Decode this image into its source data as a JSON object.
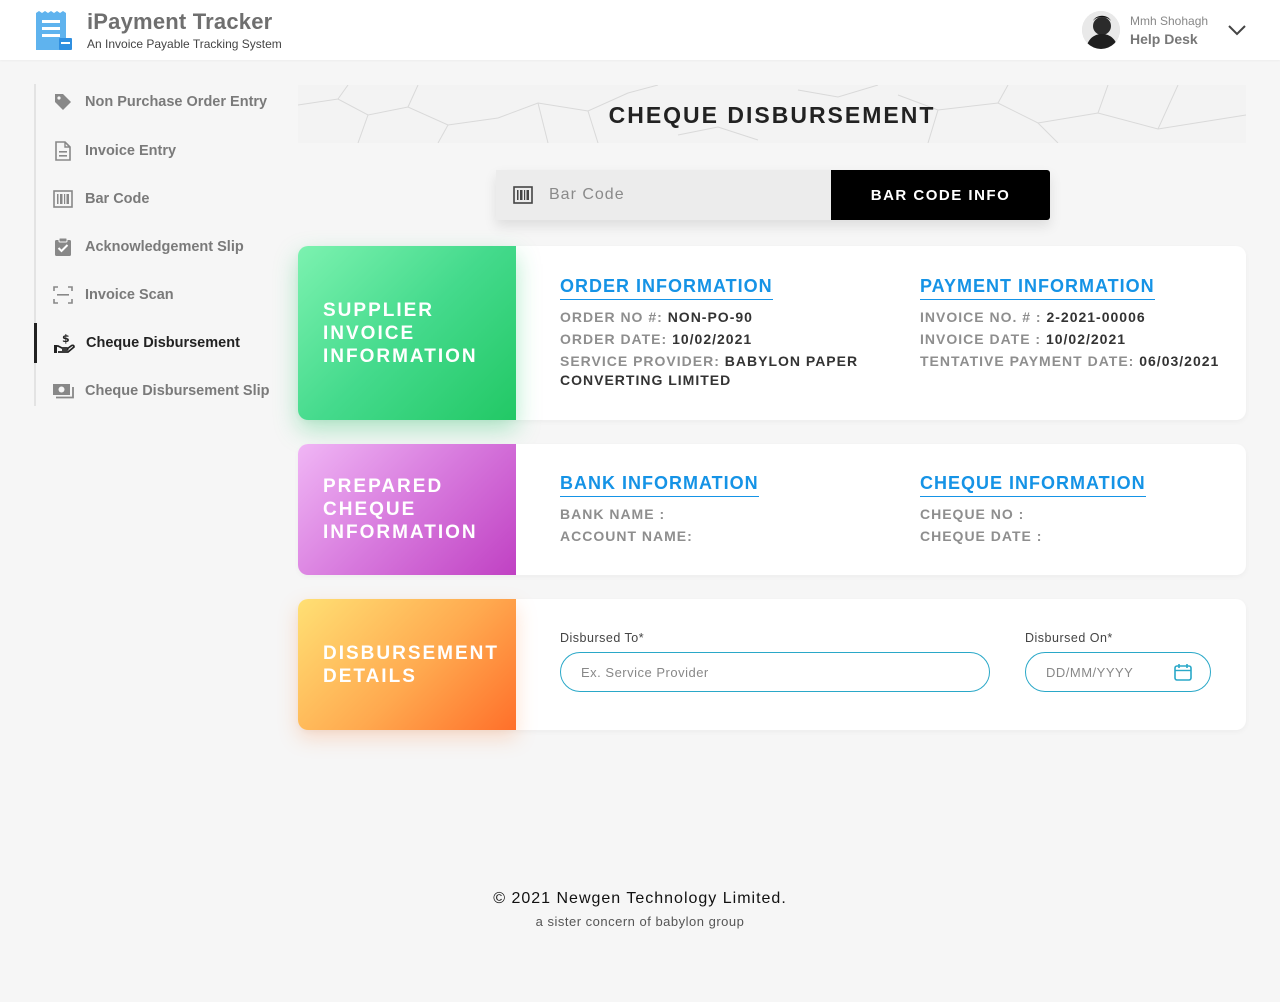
{
  "header": {
    "app_title": "iPayment Tracker",
    "app_subtitle": "An Invoice Payable Tracking System",
    "user_name": "Mmh Shohagh",
    "user_role": "Help Desk"
  },
  "sidebar": {
    "items": [
      {
        "label": "Non Purchase Order Entry",
        "icon": "tag-icon",
        "active": false
      },
      {
        "label": "Invoice Entry",
        "icon": "document-icon",
        "active": false
      },
      {
        "label": "Bar Code",
        "icon": "barcode-icon",
        "active": false
      },
      {
        "label": "Acknowledgement Slip",
        "icon": "clipboard-check-icon",
        "active": false
      },
      {
        "label": "Invoice Scan",
        "icon": "scan-icon",
        "active": false
      },
      {
        "label": "Cheque Disbursement",
        "icon": "hand-dollar-icon",
        "active": true
      },
      {
        "label": "Cheque Disbursement Slip",
        "icon": "cash-icon",
        "active": false
      }
    ]
  },
  "page": {
    "title": "CHEQUE DISBURSEMENT"
  },
  "barcode": {
    "placeholder": "Bar Code",
    "button_label": "BAR CODE INFO"
  },
  "supplier_card": {
    "tag": "SUPPLIER INVOICE INFORMATION",
    "order": {
      "title": "ORDER INFORMATION",
      "order_no_label": "ORDER NO #:",
      "order_no": "NON-PO-90",
      "order_date_label": "ORDER DATE:",
      "order_date": "10/02/2021",
      "provider_label": "SERVICE PROVIDER:",
      "provider": "BABYLON PAPER CONVERTING LIMITED"
    },
    "payment": {
      "title": "PAYMENT INFORMATION",
      "invoice_no_label": "INVOICE NO. # :",
      "invoice_no": "2-2021-00006",
      "invoice_date_label": "INVOICE DATE :",
      "invoice_date": "10/02/2021",
      "tentative_label": "TENTATIVE PAYMENT DATE:",
      "tentative_date": "06/03/2021"
    }
  },
  "cheque_card": {
    "tag": "PREPARED CHEQUE INFORMATION",
    "bank": {
      "title": "BANK INFORMATION",
      "bank_name_label": "BANK NAME :",
      "account_name_label": "ACCOUNT NAME:"
    },
    "cheque": {
      "title": "CHEQUE INFORMATION",
      "cheque_no_label": "CHEQUE NO :",
      "cheque_date_label": "CHEQUE DATE :"
    }
  },
  "disbursement_card": {
    "tag": "DISBURSEMENT DETAILS",
    "to_label": "Disbursed To*",
    "to_placeholder": "Ex. Service Provider",
    "on_label": "Disbursed On*",
    "on_placeholder": "DD/MM/YYYY"
  },
  "footer": {
    "copyright": "© 2021 Newgen Technology Limited.",
    "tagline": "a sister concern of babylon group"
  },
  "colors": {
    "accent_blue": "#1593e6",
    "input_border": "#2aa8c8",
    "green_tag": "#44da8c",
    "purple_tag": "#d779dd",
    "orange_tag": "#ffa94f"
  }
}
